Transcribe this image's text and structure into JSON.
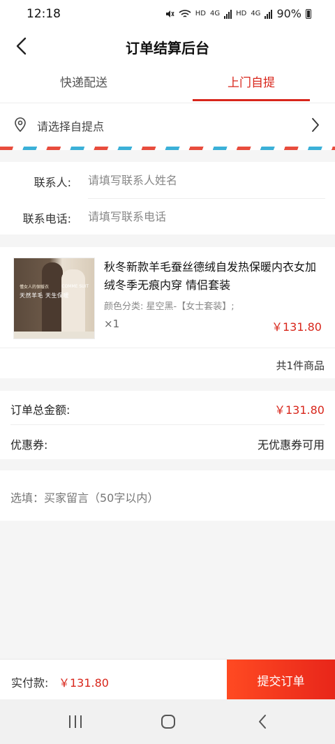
{
  "status_bar": {
    "time": "12:18",
    "network_labels": [
      "HD",
      "4G",
      "HD",
      "4G"
    ],
    "battery": "90%"
  },
  "nav": {
    "title": "订单结算后台"
  },
  "tabs": [
    {
      "label": "快递配送",
      "active": false
    },
    {
      "label": "上门自提",
      "active": true
    }
  ],
  "pickup": {
    "placeholder": "请选择自提点"
  },
  "contact": {
    "name_label": "联系人:",
    "name_placeholder": "请填写联系人姓名",
    "phone_label": "联系电话:",
    "phone_placeholder": "请填写联系电话"
  },
  "goods": {
    "image_text_1": "懂女人的保暖衣",
    "image_text_2": "天然羊毛 天生保暖",
    "image_brand": "COMME SUIT",
    "title": "秋冬新款羊毛蚕丝德绒自发热保暖内衣女加绒冬季无痕内穿 情侣套装",
    "sku": "颜色分类: 星空黑-【女士套装】;",
    "quantity": "×1",
    "price": "￥131.80",
    "count_text": "共1件商品"
  },
  "amounts": {
    "total_label": "订单总金额:",
    "total_value": "￥131.80",
    "coupon_label": "优惠券:",
    "coupon_value": "无优惠券可用"
  },
  "remark": {
    "placeholder": "选填：买家留言（50字以内）"
  },
  "bottom": {
    "pay_label": "实付款:",
    "pay_amount": "￥131.80",
    "submit_label": "提交订单"
  },
  "colors": {
    "accent": "#d8261b",
    "submit_gradient_start": "#ff4a22",
    "submit_gradient_end": "#e8261a"
  },
  "icons": [
    "back-arrow-icon",
    "location-pin-icon",
    "chevron-right-icon",
    "recent-apps-icon",
    "home-icon",
    "system-back-icon"
  ]
}
